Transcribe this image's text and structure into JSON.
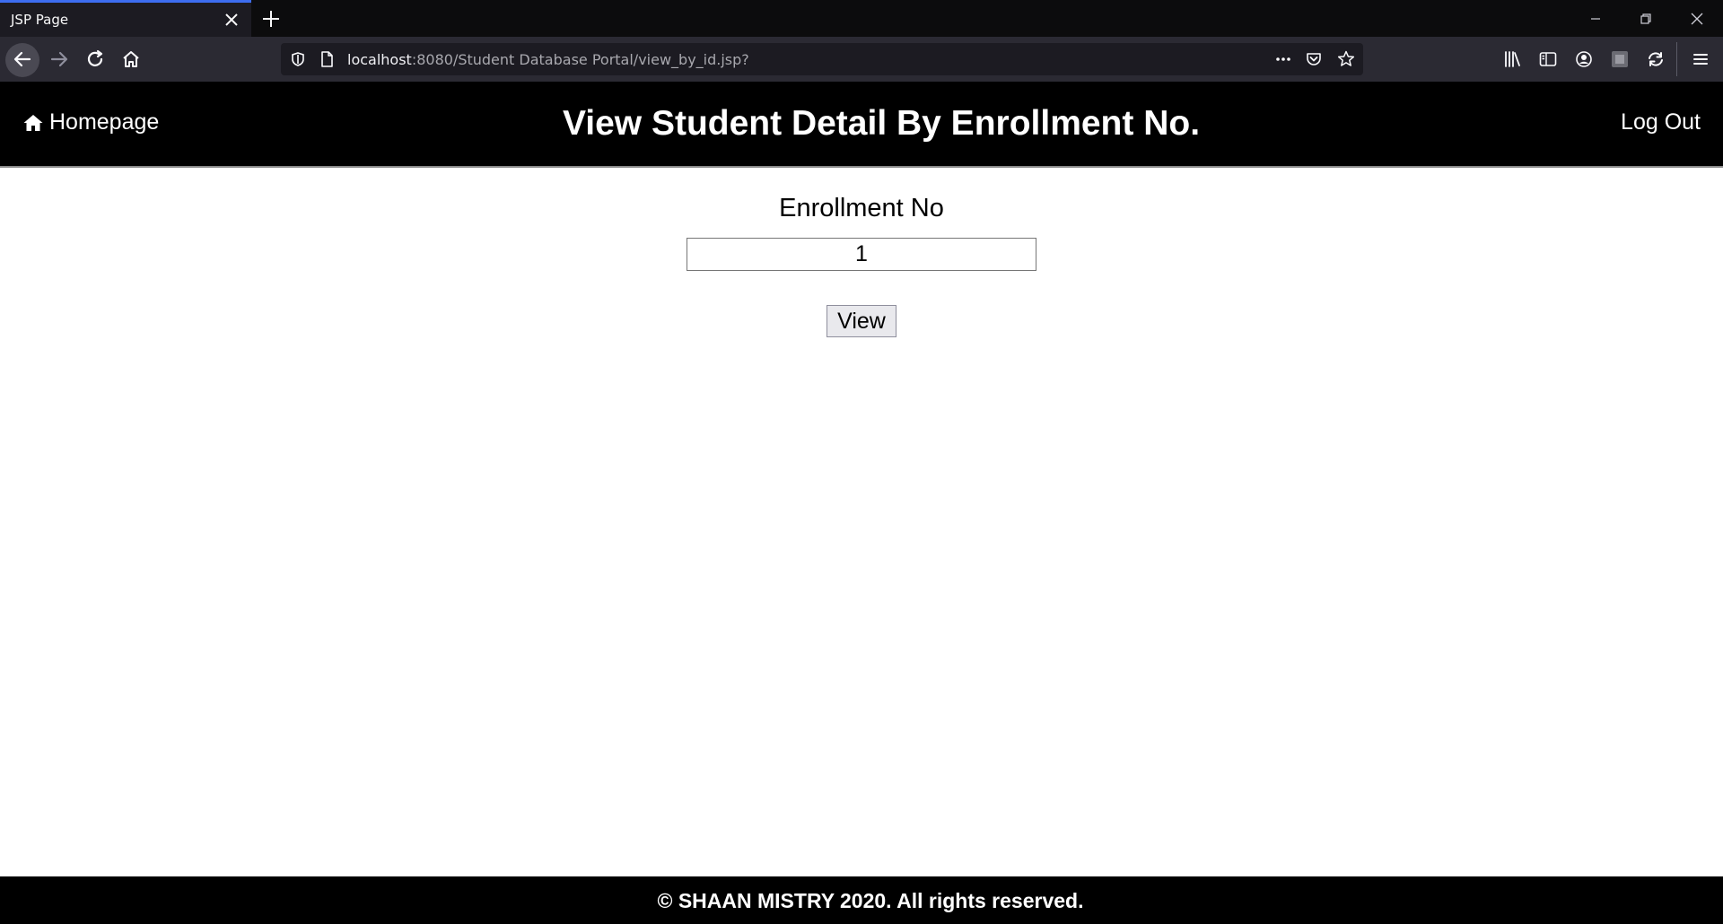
{
  "browser": {
    "tab_title": "JSP Page",
    "url_host": "localhost",
    "url_rest": ":8080/Student Database Portal/view_by_id.jsp?"
  },
  "header": {
    "home_label": "Homepage",
    "title": "View Student Detail By Enrollment No.",
    "logout_label": "Log Out"
  },
  "form": {
    "label": "Enrollment No",
    "enrollment_value": "1",
    "view_button": "View"
  },
  "footer": {
    "text": "© SHAAN MISTRY 2020. All rights reserved."
  },
  "colors": {
    "header_bg": "#000000",
    "footer_bg": "#000000",
    "tab_accent": "#3d6df0"
  }
}
